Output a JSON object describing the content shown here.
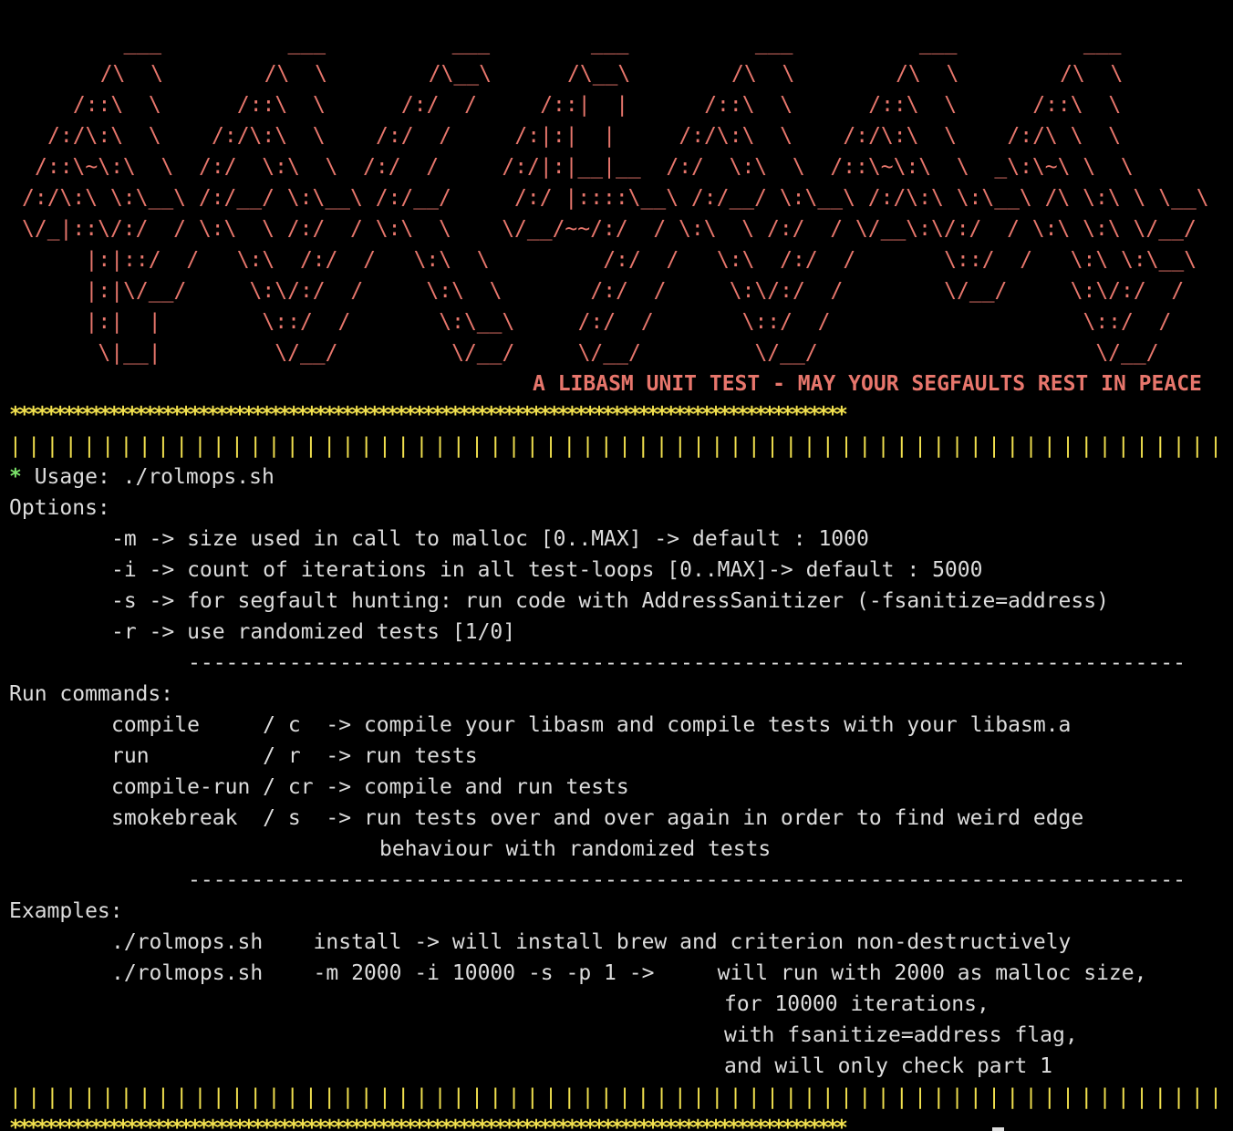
{
  "ascii_art": [
    "   ___          ___          ___        ___          ___          ___          ___",
    "  /\\  \\        /\\  \\        /\\__\\      /\\__\\        /\\  \\        /\\  \\        /\\  \\",
    " /::\\  \\      /::\\  \\      /:/  /     /::|  |      /::\\  \\      /::\\  \\      /::\\  \\",
    "/:/\\:\\  \\    /:/\\:\\  \\    /:/  /     /:|:|  |     /:/\\:\\  \\    /:/\\:\\  \\    /:/\\ \\  \\",
    "/::\\~\\:\\  \\  /:/  \\:\\  \\  /:/  /     /:/|:|__|__  /:/  \\:\\  \\  /::\\~\\:\\  \\  _\\:\\~\\ \\  \\",
    "/:/\\:\\ \\:\\__\\ /:/__/ \\:\\__\\ /:/__/     /:/ |::::\\__\\ /:/__/ \\:\\__\\ /:/\\:\\ \\:\\__\\ /\\ \\:\\ \\ \\__\\",
    "\\/_|::\\/:/  / \\:\\  \\ /:/  / \\:\\  \\    \\/__/~~/:/  / \\:\\  \\ /:/  / \\/__\\:\\/:/  / \\:\\ \\:\\ \\/__/",
    "   |:|::/  /   \\:\\  /:/  /   \\:\\  \\         /:/  /   \\:\\  /:/  /       \\::/  /   \\:\\ \\:\\__\\",
    "   |:|\\/__/     \\:\\/:/  /     \\:\\  \\       /:/  /     \\:\\/:/  /        \\/__/     \\:\\/:/  /",
    "   |:|  |        \\::/  /       \\:\\__\\     /:/  /       \\::/  /                    \\::/  /",
    "    \\|__|         \\/__/         \\/__/     \\/__/         \\/__/                      \\/__/"
  ],
  "tagline": "A LIBASM UNIT TEST - MAY YOUR SEGFAULTS REST IN PEACE",
  "stars_border": "*********************************************************************************************",
  "pipes_border": "||||||||||||||||||||||||||||||||||||||||||||||||||||||||||||||||||||||||||||||||||||||||||||||",
  "usage": {
    "bullet": "*",
    "text": " Usage: ./rolmops.sh"
  },
  "options": {
    "heading": "Options:",
    "items": [
      "-m -> size used in call to malloc [0..MAX] -> default : 1000",
      "-i -> count of iterations in all test-loops [0..MAX]-> default : 5000",
      "-s -> for segfault hunting: run code with AddressSanitizer (-fsanitize=address)",
      "-r -> use randomized tests [1/0]"
    ]
  },
  "separator": "-------------------------------------------------------------------------------",
  "run_commands": {
    "heading": "Run commands:",
    "items": [
      "compile     / c  -> compile your libasm and compile tests with your libasm.a",
      "run         / r  -> run tests",
      "compile-run / cr -> compile and run tests",
      "smokebreak  / s  -> run tests over and over again in order to find weird edge"
    ],
    "continuation": "behaviour with randomized tests"
  },
  "examples": {
    "heading": "Examples:",
    "items": [
      "./rolmops.sh    install -> will install brew and criterion non-destructively",
      "./rolmops.sh    -m 2000 -i 10000 -s -p 1 ->     will run with 2000 as malloc size,"
    ],
    "continuation": [
      "for 10000 iterations,",
      "with fsanitize=address flag,",
      "and will only check part 1"
    ]
  },
  "colors": {
    "background": "#000000",
    "text": "#dcdcdc",
    "art": "#e7766c",
    "border": "#f1e04e",
    "bullet": "#7be36a"
  }
}
